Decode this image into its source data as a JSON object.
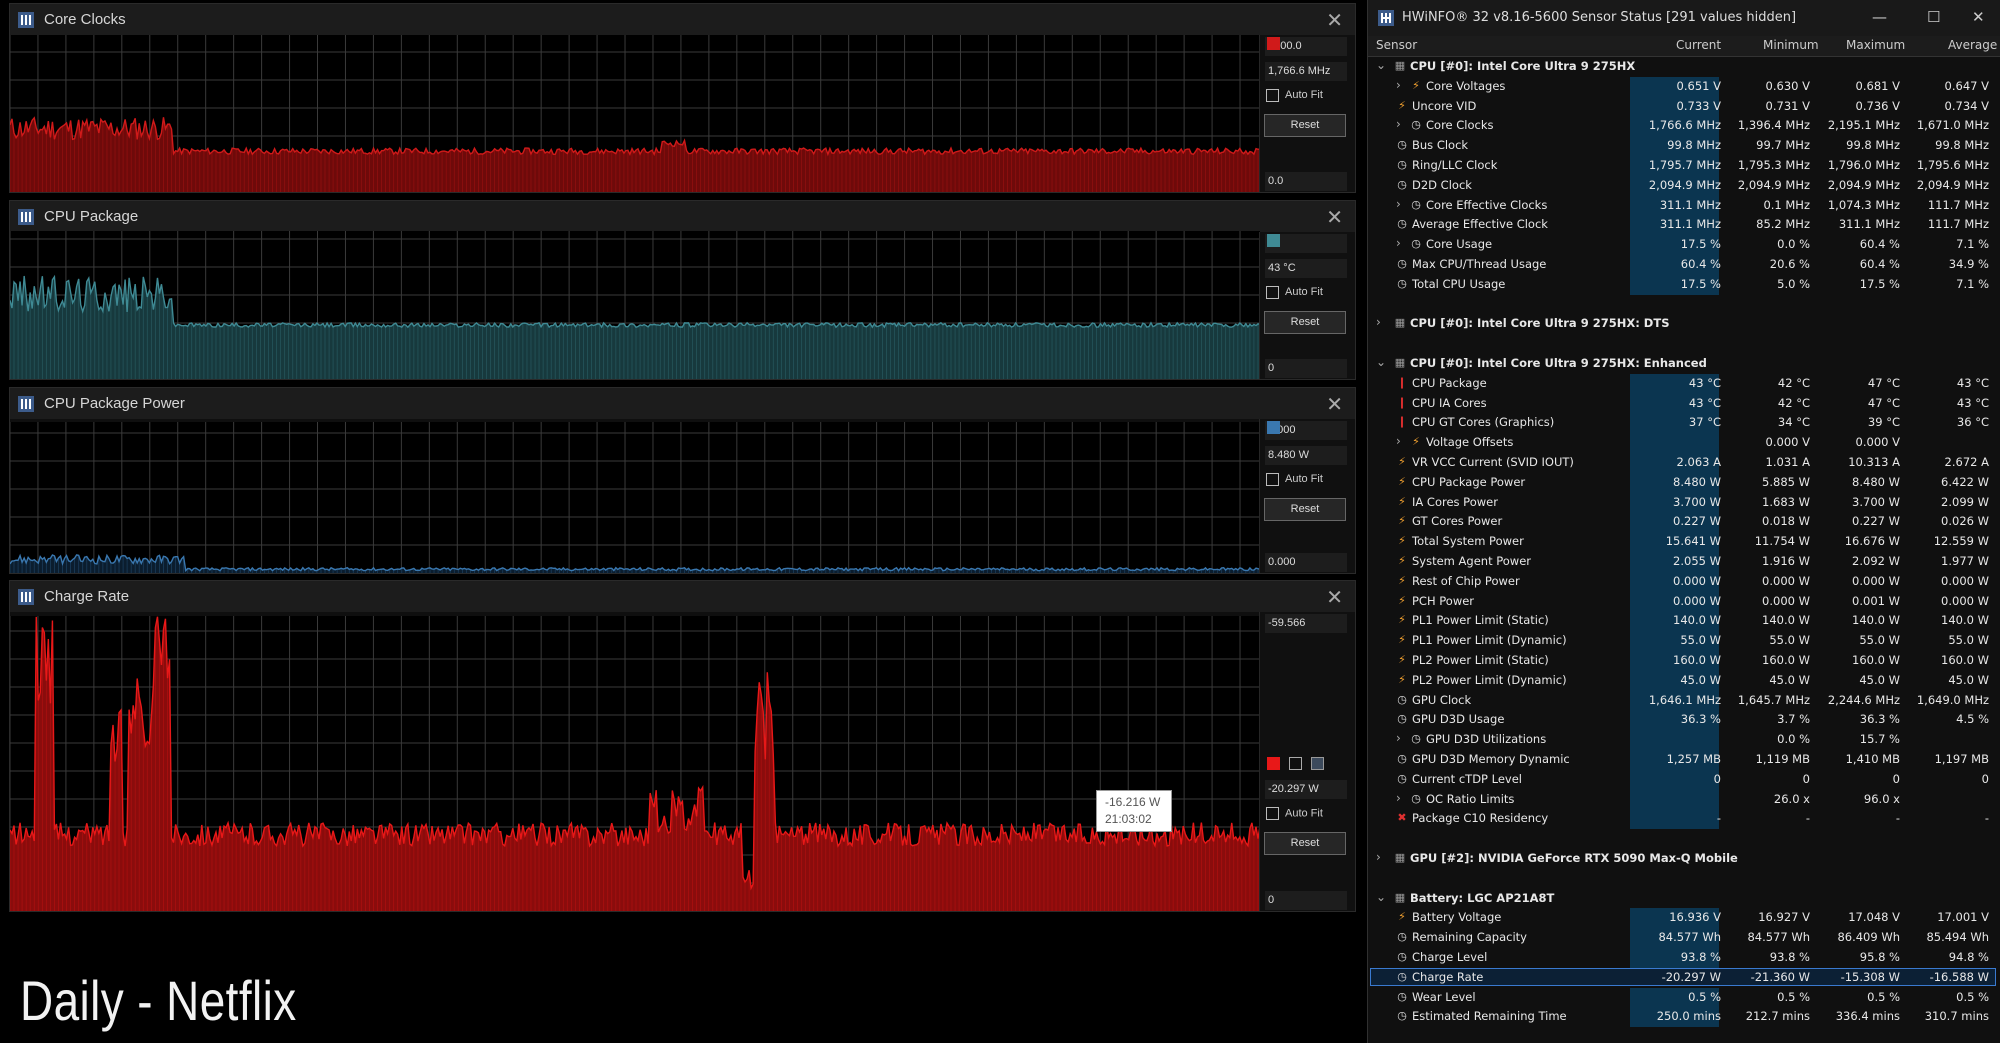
{
  "colors": {
    "red": "#e81818",
    "teal": "#3f8a94",
    "blue": "#3a78b0",
    "bg": "#000000"
  },
  "graphs": [
    {
      "title": "Core Clocks",
      "top_value": "2200.0",
      "current": "1,766.6 MHz",
      "auto_fit": "Auto Fit",
      "reset": "Reset",
      "bottom_value": "0.0",
      "color": "#d01a1a",
      "fill": "#6e0a0a"
    },
    {
      "title": "CPU Package",
      "top_value": "",
      "current": "43 °C",
      "auto_fit": "Auto Fit",
      "reset": "Reset",
      "bottom_value": "0",
      "color": "#3f8a94",
      "fill": "#17393d"
    },
    {
      "title": "CPU Package Power",
      "top_value": "9.000",
      "current": "8.480 W",
      "auto_fit": "Auto Fit",
      "reset": "Reset",
      "bottom_value": "0.000",
      "color": "#3a78b0",
      "fill": "#0b1d2e"
    },
    {
      "title": "Charge Rate",
      "top_value": "-59.566",
      "current": "-20.297 W",
      "auto_fit": "Auto Fit",
      "reset": "Reset",
      "bottom_value": "0",
      "color": "#e81818",
      "fill": "#8a0c0c"
    }
  ],
  "tooltip": {
    "value": "-16.216 W",
    "time": "21:03:02"
  },
  "caption": "Daily - Netflix",
  "hwinfo": {
    "title": "HWiNFO® 32 v8.16-5600 Sensor Status [291 values hidden]",
    "headers": [
      "Sensor",
      "Current",
      "Minimum",
      "Maximum",
      "Average"
    ],
    "rows": [
      {
        "k": "grp",
        "n": "CPU [#0]: Intel Core Ultra 9 275HX",
        "exp": "⌄",
        "ic": "chip"
      },
      {
        "k": "sub",
        "n": "Core Voltages",
        "exp": "›",
        "ic": "bolt",
        "v": [
          "0.651 V",
          "0.630 V",
          "0.681 V",
          "0.647 V"
        ]
      },
      {
        "k": "row",
        "n": "Uncore VID",
        "ic": "bolt",
        "v": [
          "0.733 V",
          "0.731 V",
          "0.736 V",
          "0.734 V"
        ]
      },
      {
        "k": "sub",
        "n": "Core Clocks",
        "exp": "›",
        "ic": "clock",
        "v": [
          "1,766.6 MHz",
          "1,396.4 MHz",
          "2,195.1 MHz",
          "1,671.0 MHz"
        ]
      },
      {
        "k": "row",
        "n": "Bus Clock",
        "ic": "clock",
        "v": [
          "99.8 MHz",
          "99.7 MHz",
          "99.8 MHz",
          "99.8 MHz"
        ]
      },
      {
        "k": "row",
        "n": "Ring/LLC Clock",
        "ic": "clock",
        "v": [
          "1,795.7 MHz",
          "1,795.3 MHz",
          "1,796.0 MHz",
          "1,795.6 MHz"
        ]
      },
      {
        "k": "row",
        "n": "D2D Clock",
        "ic": "clock",
        "v": [
          "2,094.9 MHz",
          "2,094.9 MHz",
          "2,094.9 MHz",
          "2,094.9 MHz"
        ]
      },
      {
        "k": "sub",
        "n": "Core Effective Clocks",
        "exp": "›",
        "ic": "clock",
        "v": [
          "311.1 MHz",
          "0.1 MHz",
          "1,074.3 MHz",
          "111.7 MHz"
        ]
      },
      {
        "k": "row",
        "n": "Average Effective Clock",
        "ic": "clock",
        "v": [
          "311.1 MHz",
          "85.2 MHz",
          "311.1 MHz",
          "111.7 MHz"
        ]
      },
      {
        "k": "sub",
        "n": "Core Usage",
        "exp": "›",
        "ic": "clock",
        "v": [
          "17.5 %",
          "0.0 %",
          "60.4 %",
          "7.1 %"
        ]
      },
      {
        "k": "row",
        "n": "Max CPU/Thread Usage",
        "ic": "clock",
        "v": [
          "60.4 %",
          "20.6 %",
          "60.4 %",
          "34.9 %"
        ]
      },
      {
        "k": "row",
        "n": "Total CPU Usage",
        "ic": "clock",
        "v": [
          "17.5 %",
          "5.0 %",
          "17.5 %",
          "7.1 %"
        ]
      },
      {
        "k": "blank"
      },
      {
        "k": "grp",
        "n": "CPU [#0]: Intel Core Ultra 9 275HX: DTS",
        "exp": "›",
        "ic": "chip"
      },
      {
        "k": "blank"
      },
      {
        "k": "grp",
        "n": "CPU [#0]: Intel Core Ultra 9 275HX: Enhanced",
        "exp": "⌄",
        "ic": "chip"
      },
      {
        "k": "row",
        "n": "CPU Package",
        "ic": "therm",
        "v": [
          "43 °C",
          "42 °C",
          "47 °C",
          "43 °C"
        ]
      },
      {
        "k": "row",
        "n": "CPU IA Cores",
        "ic": "therm",
        "v": [
          "43 °C",
          "42 °C",
          "47 °C",
          "43 °C"
        ]
      },
      {
        "k": "row",
        "n": "CPU GT Cores (Graphics)",
        "ic": "therm",
        "v": [
          "37 °C",
          "34 °C",
          "39 °C",
          "36 °C"
        ]
      },
      {
        "k": "sub",
        "n": "Voltage Offsets",
        "exp": "›",
        "ic": "bolt",
        "v": [
          "",
          "0.000 V",
          "0.000 V",
          ""
        ]
      },
      {
        "k": "row",
        "n": "VR VCC Current (SVID IOUT)",
        "ic": "bolt",
        "v": [
          "2.063 A",
          "1.031 A",
          "10.313 A",
          "2.672 A"
        ]
      },
      {
        "k": "row",
        "n": "CPU Package Power",
        "ic": "bolt",
        "v": [
          "8.480 W",
          "5.885 W",
          "8.480 W",
          "6.422 W"
        ]
      },
      {
        "k": "row",
        "n": "IA Cores Power",
        "ic": "bolt",
        "v": [
          "3.700 W",
          "1.683 W",
          "3.700 W",
          "2.099 W"
        ]
      },
      {
        "k": "row",
        "n": "GT Cores Power",
        "ic": "bolt",
        "v": [
          "0.227 W",
          "0.018 W",
          "0.227 W",
          "0.026 W"
        ]
      },
      {
        "k": "row",
        "n": "Total System Power",
        "ic": "bolt",
        "v": [
          "15.641 W",
          "11.754 W",
          "16.676 W",
          "12.559 W"
        ]
      },
      {
        "k": "row",
        "n": "System Agent Power",
        "ic": "bolt",
        "v": [
          "2.055 W",
          "1.916 W",
          "2.092 W",
          "1.977 W"
        ]
      },
      {
        "k": "row",
        "n": "Rest of Chip Power",
        "ic": "bolt",
        "v": [
          "0.000 W",
          "0.000 W",
          "0.000 W",
          "0.000 W"
        ]
      },
      {
        "k": "row",
        "n": "PCH Power",
        "ic": "bolt",
        "v": [
          "0.000 W",
          "0.000 W",
          "0.001 W",
          "0.000 W"
        ]
      },
      {
        "k": "row",
        "n": "PL1 Power Limit (Static)",
        "ic": "bolt",
        "v": [
          "140.0 W",
          "140.0 W",
          "140.0 W",
          "140.0 W"
        ]
      },
      {
        "k": "row",
        "n": "PL1 Power Limit (Dynamic)",
        "ic": "bolt",
        "v": [
          "55.0 W",
          "55.0 W",
          "55.0 W",
          "55.0 W"
        ]
      },
      {
        "k": "row",
        "n": "PL2 Power Limit (Static)",
        "ic": "bolt",
        "v": [
          "160.0 W",
          "160.0 W",
          "160.0 W",
          "160.0 W"
        ]
      },
      {
        "k": "row",
        "n": "PL2 Power Limit (Dynamic)",
        "ic": "bolt",
        "v": [
          "45.0 W",
          "45.0 W",
          "45.0 W",
          "45.0 W"
        ]
      },
      {
        "k": "row",
        "n": "GPU Clock",
        "ic": "clock",
        "v": [
          "1,646.1 MHz",
          "1,645.7 MHz",
          "2,244.6 MHz",
          "1,649.0 MHz"
        ]
      },
      {
        "k": "row",
        "n": "GPU D3D Usage",
        "ic": "clock",
        "v": [
          "36.3 %",
          "3.7 %",
          "36.3 %",
          "4.5 %"
        ]
      },
      {
        "k": "sub",
        "n": "GPU D3D Utilizations",
        "exp": "›",
        "ic": "clock",
        "v": [
          "",
          "0.0 %",
          "15.7 %",
          ""
        ]
      },
      {
        "k": "row",
        "n": "GPU D3D Memory Dynamic",
        "ic": "clock",
        "v": [
          "1,257 MB",
          "1,119 MB",
          "1,410 MB",
          "1,197 MB"
        ]
      },
      {
        "k": "row",
        "n": "Current cTDP Level",
        "ic": "clock",
        "v": [
          "0",
          "0",
          "0",
          "0"
        ]
      },
      {
        "k": "sub",
        "n": "OC Ratio Limits",
        "exp": "›",
        "ic": "clock",
        "v": [
          "",
          "26.0 x",
          "96.0 x",
          ""
        ]
      },
      {
        "k": "row",
        "n": "Package C10 Residency",
        "ic": "x",
        "v": [
          "-",
          "-",
          "-",
          "-"
        ]
      },
      {
        "k": "blank"
      },
      {
        "k": "grp",
        "n": "GPU [#2]: NVIDIA  GeForce RTX 5090 Max-Q Mobile",
        "exp": "›",
        "ic": "chip"
      },
      {
        "k": "blank"
      },
      {
        "k": "grp",
        "n": "Battery: LGC AP21A8T",
        "exp": "⌄",
        "ic": "chip"
      },
      {
        "k": "row",
        "n": "Battery Voltage",
        "ic": "bolt",
        "v": [
          "16.936 V",
          "16.927 V",
          "17.048 V",
          "17.001 V"
        ]
      },
      {
        "k": "row",
        "n": "Remaining Capacity",
        "ic": "clock",
        "v": [
          "84.577 Wh",
          "84.577 Wh",
          "86.409 Wh",
          "85.494 Wh"
        ]
      },
      {
        "k": "row",
        "n": "Charge Level",
        "ic": "clock",
        "v": [
          "93.8 %",
          "93.8 %",
          "95.8 %",
          "94.8 %"
        ]
      },
      {
        "k": "sel",
        "n": "Charge Rate",
        "ic": "clock",
        "v": [
          "-20.297 W",
          "-21.360 W",
          "-15.308 W",
          "-16.588 W"
        ]
      },
      {
        "k": "row",
        "n": "Wear Level",
        "ic": "clock",
        "v": [
          "0.5 %",
          "0.5 %",
          "0.5 %",
          "0.5 %"
        ]
      },
      {
        "k": "row",
        "n": "Estimated Remaining Time",
        "ic": "clock",
        "v": [
          "250.0 mins",
          "212.7 mins",
          "336.4 mins",
          "310.7 mins"
        ]
      }
    ]
  }
}
